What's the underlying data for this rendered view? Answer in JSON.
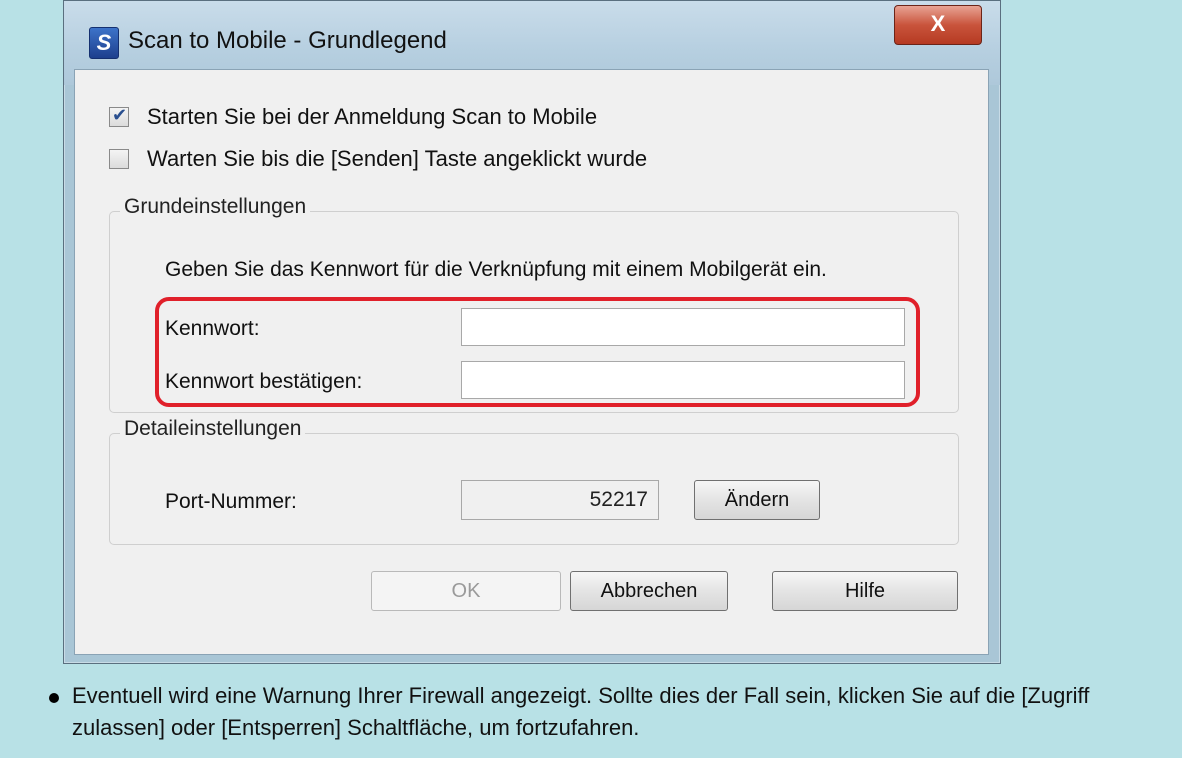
{
  "window": {
    "title": "Scan to Mobile - Grundlegend",
    "close_glyph": "X"
  },
  "options": {
    "start_at_login": {
      "label": "Starten Sie bei der Anmeldung Scan to Mobile",
      "checked": true
    },
    "wait_for_send": {
      "label": "Warten Sie bis die [Senden] Taste angeklickt wurde",
      "checked": false
    }
  },
  "basic_settings": {
    "legend": "Grundeinstellungen",
    "instruction": "Geben Sie das Kennwort für die Verknüpfung mit einem Mobilgerät ein.",
    "password_label": "Kennwort:",
    "password_value": "",
    "confirm_label": "Kennwort bestätigen:",
    "confirm_value": ""
  },
  "detail_settings": {
    "legend": "Detaileinstellungen",
    "port_label": "Port-Nummer:",
    "port_value": "52217",
    "change_button": "Ändern"
  },
  "buttons": {
    "ok": "OK",
    "cancel": "Abbrechen",
    "help": "Hilfe"
  },
  "note": "Eventuell wird eine Warnung Ihrer Firewall angezeigt. Sollte dies der Fall sein, klicken Sie auf die [Zugriff zulassen] oder [Entsperren] Schaltfläche, um fortzufahren.",
  "colors": {
    "highlight": "#e0202a",
    "page_background": "#b8e1e6"
  }
}
